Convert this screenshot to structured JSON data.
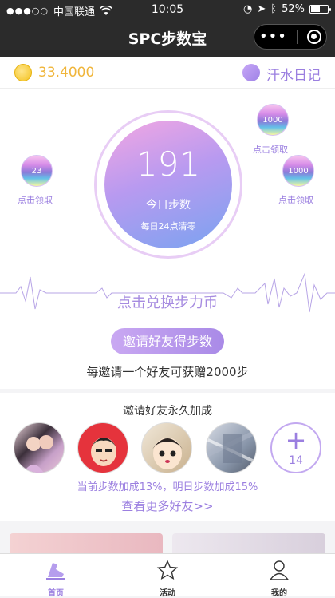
{
  "status": {
    "carrier": "中国联通",
    "time": "10:05",
    "battery": "52%",
    "battery_level": 0.52
  },
  "nav": {
    "title": "SPC步数宝"
  },
  "balance": {
    "value": "33.4000",
    "diary_label": "汗水日记"
  },
  "steps": {
    "count": "191",
    "label": "今日步数",
    "reset_note": "每日24点清零"
  },
  "bubbles": [
    {
      "value": "1000",
      "label": "点击领取"
    },
    {
      "value": "23",
      "label": "点击领取"
    },
    {
      "value": "1000",
      "label": "点击领取"
    }
  ],
  "exchange_label": "点击兑换步力币",
  "invite": {
    "button_label": "邀请好友得步数",
    "description": "每邀请一个好友可获赠2000步"
  },
  "friends": {
    "title": "邀请好友永久加成",
    "extra_count": "14",
    "bonus_desc": "当前步数加成13%，明日步数加成15%",
    "more_link": "查看更多好友>>"
  },
  "tabs": [
    {
      "label": "首页",
      "active": true
    },
    {
      "label": "活动",
      "active": false
    },
    {
      "label": "我的",
      "active": false
    }
  ],
  "colors": {
    "accent": "#9b7fe0",
    "coin": "#f0b53a"
  }
}
